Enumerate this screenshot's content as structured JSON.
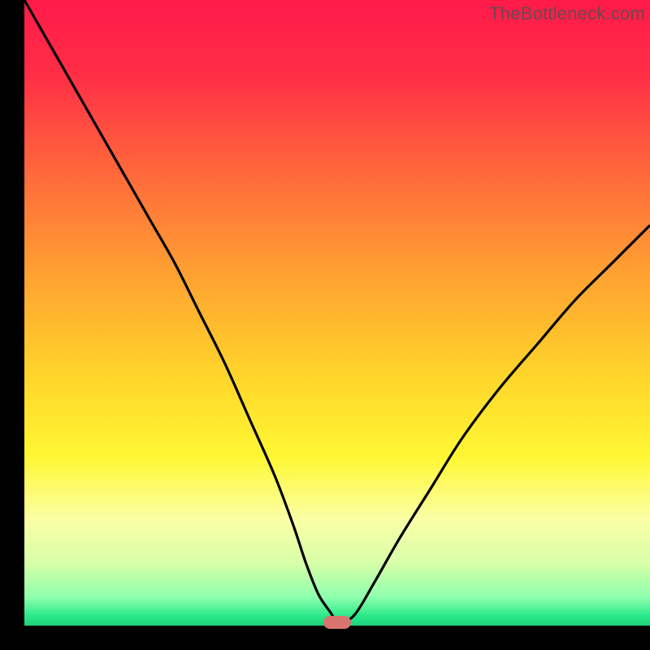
{
  "watermark": "TheBottleneck.com",
  "chart_data": {
    "type": "line",
    "title": "",
    "xlabel": "",
    "ylabel": "",
    "xlim": [
      0,
      100
    ],
    "ylim": [
      0,
      100
    ],
    "gradient_stops": [
      {
        "pos": 0.0,
        "color": "#ff1a4a"
      },
      {
        "pos": 0.12,
        "color": "#ff2e46"
      },
      {
        "pos": 0.28,
        "color": "#ff6a3b"
      },
      {
        "pos": 0.45,
        "color": "#ffa531"
      },
      {
        "pos": 0.6,
        "color": "#ffd52a"
      },
      {
        "pos": 0.73,
        "color": "#fff733"
      },
      {
        "pos": 0.83,
        "color": "#fbffa6"
      },
      {
        "pos": 0.9,
        "color": "#d8ffa8"
      },
      {
        "pos": 0.955,
        "color": "#8dffad"
      },
      {
        "pos": 0.985,
        "color": "#29e88a"
      },
      {
        "pos": 1.0,
        "color": "#1fd079"
      }
    ],
    "series": [
      {
        "name": "bottleneck-curve",
        "x": [
          0,
          4,
          8,
          12,
          16,
          20,
          24,
          28,
          32,
          36,
          40,
          43,
          45,
          47,
          49,
          50,
          51,
          53,
          56,
          60,
          65,
          70,
          76,
          82,
          88,
          94,
          100
        ],
        "y": [
          100,
          93,
          86,
          79,
          72,
          65,
          58,
          50,
          42,
          33,
          24,
          16,
          10,
          5,
          2,
          0.5,
          0.5,
          2,
          7,
          14,
          22,
          30,
          38,
          45,
          52,
          58,
          64
        ]
      }
    ],
    "marker": {
      "x": 50,
      "y": 0.5,
      "color": "#d8746f"
    }
  }
}
